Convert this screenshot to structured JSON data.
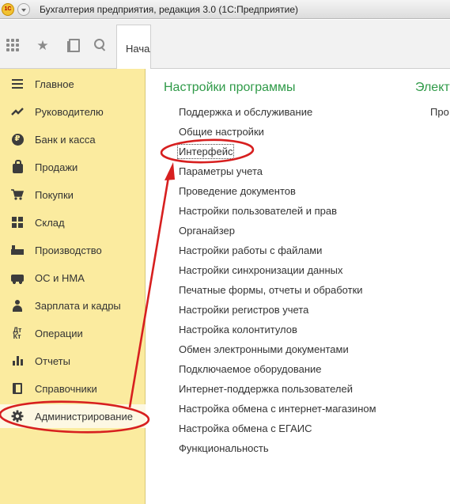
{
  "window": {
    "app_logo_text": "1С",
    "title": "Бухгалтерия предприятия, редакция 3.0  (1С:Предприятие)"
  },
  "toolbar": {
    "icons": [
      "apps-grid-icon",
      "star-icon",
      "history-icon",
      "search-icon"
    ],
    "tab_label": "Начальная страница"
  },
  "sidebar": {
    "items": [
      {
        "label": "Главное",
        "icon": "menu-icon"
      },
      {
        "label": "Руководителю",
        "icon": "trend-icon"
      },
      {
        "label": "Банк и касса",
        "icon": "ruble-coin-icon"
      },
      {
        "label": "Продажи",
        "icon": "shopping-bag-icon"
      },
      {
        "label": "Покупки",
        "icon": "cart-icon"
      },
      {
        "label": "Склад",
        "icon": "warehouse-icon"
      },
      {
        "label": "Производство",
        "icon": "factory-icon"
      },
      {
        "label": "ОС и НМА",
        "icon": "vehicle-icon"
      },
      {
        "label": "Зарплата и кадры",
        "icon": "person-icon"
      },
      {
        "label": "Операции",
        "icon": "operations-icon"
      },
      {
        "label": "Отчеты",
        "icon": "bar-chart-icon"
      },
      {
        "label": "Справочники",
        "icon": "book-icon"
      },
      {
        "label": "Администрирование",
        "icon": "gear-icon",
        "active": true
      }
    ],
    "ops_icon_text": "Дт\nКт"
  },
  "main": {
    "section_title": "Настройки программы",
    "section_title_right": "Элект",
    "right_link": "Про",
    "links": [
      "Поддержка и обслуживание",
      "Общие настройки",
      "Интерфейс",
      "Параметры учета",
      "Проведение документов",
      "Настройки пользователей и прав",
      "Органайзер",
      "Настройки работы с файлами",
      "Настройки синхронизации данных",
      "Печатные формы, отчеты и обработки",
      "Настройки регистров учета",
      "Настройка колонтитулов",
      "Обмен электронными документами",
      "Подключаемое оборудование",
      "Интернет-поддержка пользователей",
      "Настройка обмена с интернет-магазином",
      "Настройка обмена с ЕГАИС",
      "Функциональность"
    ],
    "focused_link": "Интерфейс"
  },
  "colors": {
    "sidebar_bg": "#fbeb9f",
    "section_title": "#2f9a48",
    "annotation": "#d71f1f"
  }
}
